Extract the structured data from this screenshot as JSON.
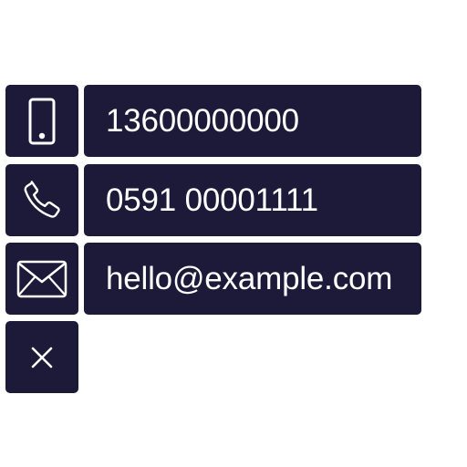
{
  "contacts": [
    {
      "icon": "mobile-phone-icon",
      "value": "13600000000"
    },
    {
      "icon": "telephone-icon",
      "value": "0591 00001111"
    },
    {
      "icon": "envelope-icon",
      "value": "hello@example.com"
    }
  ],
  "close": {
    "icon": "close-icon"
  },
  "colors": {
    "tile_background": "#1c1a38",
    "text": "#ffffff",
    "page_background": "#ffffff"
  }
}
